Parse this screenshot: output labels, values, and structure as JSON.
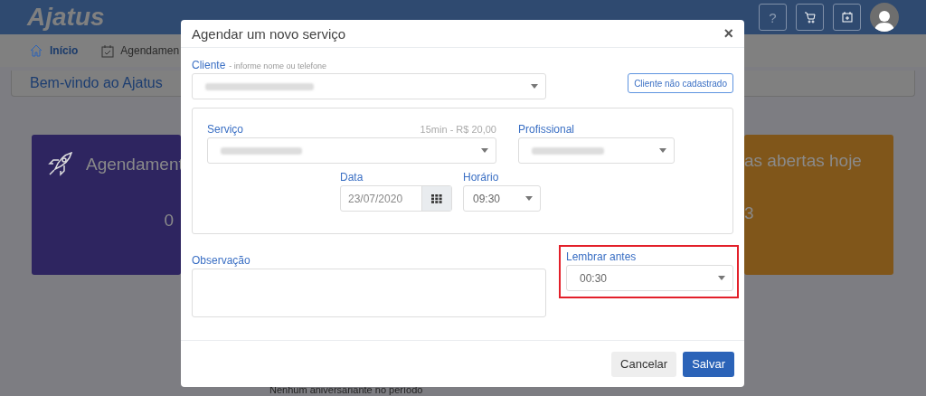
{
  "header": {
    "logo": "Ajatus",
    "buttons": [
      {
        "kind": "help",
        "label": "?"
      },
      {
        "kind": "cart"
      },
      {
        "kind": "calendar"
      },
      {
        "kind": "avatar"
      }
    ]
  },
  "nav": [
    {
      "kind": "home",
      "label": "Início",
      "selected": true
    },
    {
      "kind": "calendar",
      "label": "Agendamen",
      "selected": false
    }
  ],
  "welcome": "Bem-vindo ao Ajatus",
  "cards": [
    {
      "kind": "rocket",
      "title": "Agendament",
      "value": "0",
      "color": "#2e2560"
    },
    {
      "kind": "plain",
      "title": "as abertas hoje",
      "value": "3",
      "color": "#80561a"
    }
  ],
  "birthdays": "Nenhum aniversariante no período",
  "modal": {
    "title": "Agendar um novo serviço",
    "close": "×",
    "client": {
      "label": "Cliente",
      "hint": "- informe nome ou telefone",
      "button": "Cliente não cadastrado"
    },
    "service": {
      "label": "Serviço",
      "info": "15min - R$ 20,00"
    },
    "professional": {
      "label": "Profissional"
    },
    "date": {
      "label": "Data",
      "value": "23/07/2020"
    },
    "time": {
      "label": "Horário",
      "value": "09:30"
    },
    "note": {
      "label": "Observação"
    },
    "remind": {
      "label": "Lembrar antes",
      "value": "00:30",
      "highlighted": true
    },
    "buttons": [
      {
        "kind": "secondary",
        "label": "Cancelar"
      },
      {
        "kind": "primary",
        "label": "Salvar"
      }
    ]
  }
}
